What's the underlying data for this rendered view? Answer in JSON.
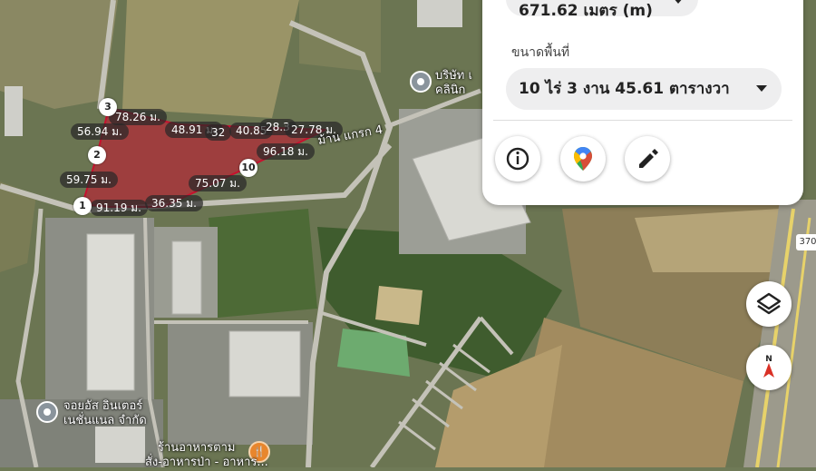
{
  "panel": {
    "distance_value": "671.62 เมตร (m)",
    "area_label": "ขนาดพื้นที่",
    "area_value": "10 ไร่ 3 งาน 45.61 ตารางวา",
    "actions": [
      "info-icon",
      "google-maps-icon",
      "edit-pencil-icon"
    ]
  },
  "polygon": {
    "fill_color": "#c8102e",
    "vertices": [
      "1",
      "2",
      "3",
      "10"
    ],
    "edge_labels": [
      "78.26 ม.",
      "56.94 ม.",
      "48.91 ม.",
      "32",
      "40.85",
      "28.3",
      "27.78 ม.",
      "96.18 ม.",
      "59.75 ม.",
      "75.07 ม.",
      "36.35 ม.",
      "91.19 ม."
    ]
  },
  "map_labels": {
    "company_top": "บริษัท เ",
    "company_top_line2": "คลินิก",
    "road": "ม้าน แกรก 4",
    "company_bottom": "จอยอัส อินเตอร์",
    "company_bottom_line2": "เนชั่นแนล จำกัด",
    "restaurant": "ร้านอาหารตาม",
    "restaurant_line2": "สั่ง-อาหารป่า - อาหาร...",
    "road_number": "370",
    "compass_letter": "N"
  },
  "controls": [
    "layers-icon",
    "compass-icon"
  ]
}
